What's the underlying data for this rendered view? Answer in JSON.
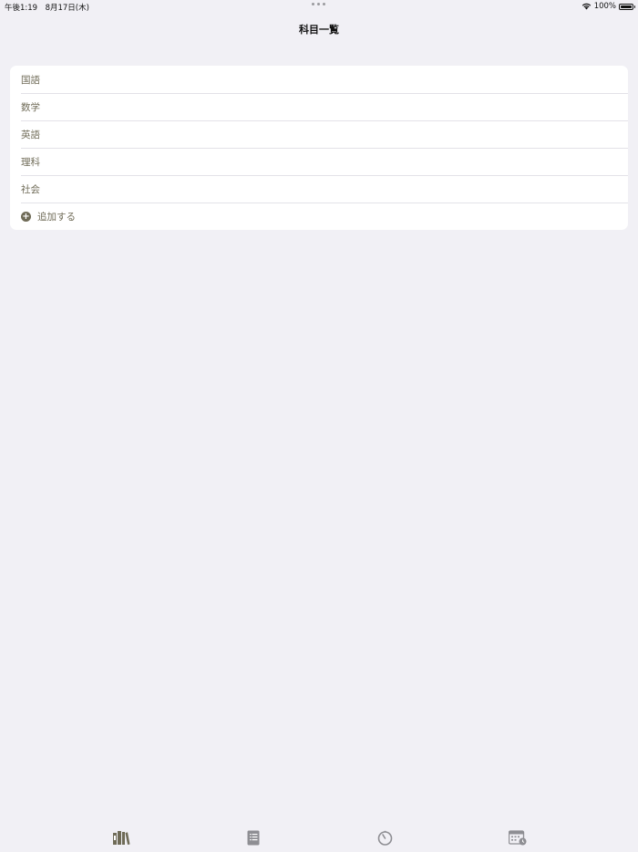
{
  "status_bar": {
    "time": "午後1:19　8月17日(木)",
    "battery": "100%"
  },
  "nav": {
    "title": "科目一覧"
  },
  "subjects": [
    {
      "label": "国語"
    },
    {
      "label": "数学"
    },
    {
      "label": "英語"
    },
    {
      "label": "理科"
    },
    {
      "label": "社会"
    }
  ],
  "add_label": "追加する",
  "colors": {
    "accent": "#6f6b57",
    "background": "#f1f0f5",
    "inactive_tab": "#8e8e93"
  },
  "tabs": [
    {
      "icon": "books-icon",
      "active": true
    },
    {
      "icon": "notebook-icon",
      "active": false
    },
    {
      "icon": "timer-icon",
      "active": false
    },
    {
      "icon": "calendar-icon",
      "active": false
    }
  ]
}
